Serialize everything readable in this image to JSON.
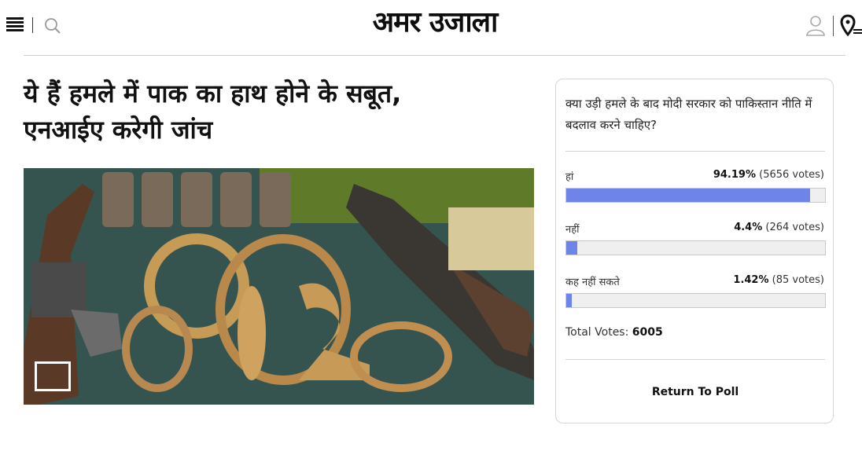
{
  "header": {
    "logo_text": "अमर उजाला",
    "menu_icon": "hamburger-menu-icon",
    "search_icon": "search-icon",
    "user_icon": "user-icon",
    "location_icon": "location-pin-icon"
  },
  "article": {
    "headline_line1": "ये हैं हमले में पाक का हाथ होने के सबूत,",
    "headline_line2": "एनआईए करेगी जांच",
    "gallery_icon": "gallery-icon"
  },
  "poll": {
    "question": "क्या उड़ी हमले के बाद मोदी सरकार को पाकिस्तान नीति में बदलाव करने चाहिए?",
    "options": [
      {
        "label": "हां",
        "percent": "94.19%",
        "votes": "(5656 votes)",
        "fraction": 0.9419
      },
      {
        "label": "नहीं",
        "percent": "4.4%",
        "votes": "(264 votes)",
        "fraction": 0.044
      },
      {
        "label": "कह नहीं सकते",
        "percent": "1.42%",
        "votes": "(85 votes)",
        "fraction": 0.0142
      }
    ],
    "total_label": "Total Votes:",
    "total_value": "6005",
    "return_label": "Return To Poll",
    "bar_color": "#6f84e8"
  }
}
